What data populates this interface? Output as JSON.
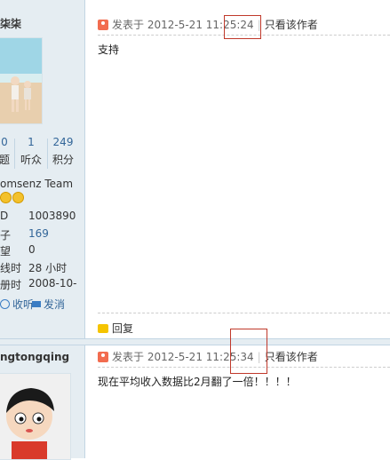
{
  "user1": {
    "name": "柒柒",
    "stats": [
      {
        "value": "0",
        "label": "题"
      },
      {
        "value": "1",
        "label": "听众"
      },
      {
        "value": "249",
        "label": "积分"
      }
    ],
    "group": "omsenz Team",
    "info": [
      {
        "label": "D",
        "value": "1003890"
      },
      {
        "label": "子",
        "value": "169"
      },
      {
        "label": "望",
        "value": "0"
      },
      {
        "label": "线时",
        "value": "28 小时"
      },
      {
        "label": "册时",
        "value": "2008-10-"
      }
    ],
    "actions": {
      "listen": "收听",
      "message": "发消"
    }
  },
  "user2": {
    "name": "ngtongqing"
  },
  "post1": {
    "posted_prefix": "发表于",
    "datetime": "2012-5-21 11:25:24",
    "only_author": "只看该作者",
    "content": "支持",
    "reply": "回复"
  },
  "post2": {
    "posted_prefix": "发表于",
    "datetime": "2012-5-21 11:25:34",
    "only_author": "只看该作者",
    "content": "现在平均收入数据比2月翻了一倍！！！！"
  },
  "colors": {
    "sidebar": "#e5edf2",
    "link": "#336699",
    "highlight_box": "#c0392b"
  }
}
